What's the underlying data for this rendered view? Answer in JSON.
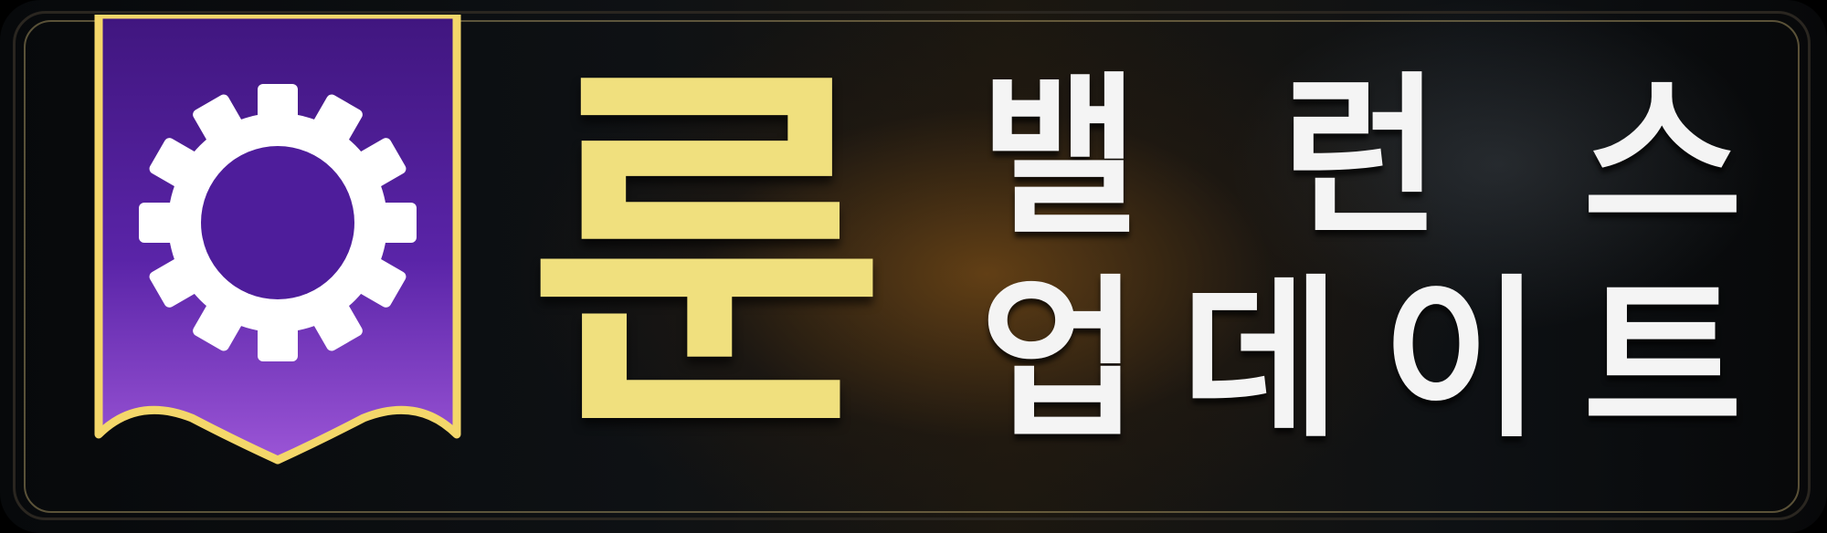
{
  "banner": {
    "rune": "룬",
    "line1": [
      "밸",
      "런",
      "스"
    ],
    "line2": [
      "업",
      "데",
      "이",
      "트"
    ]
  },
  "colors": {
    "rune_gold": "#f0e07e",
    "ribbon_purple_top": "#40167f",
    "ribbon_purple_bottom": "#9b55d6",
    "ribbon_border": "#f4d76a",
    "text_white": "#f4f4f4"
  },
  "icon": "gear-icon"
}
